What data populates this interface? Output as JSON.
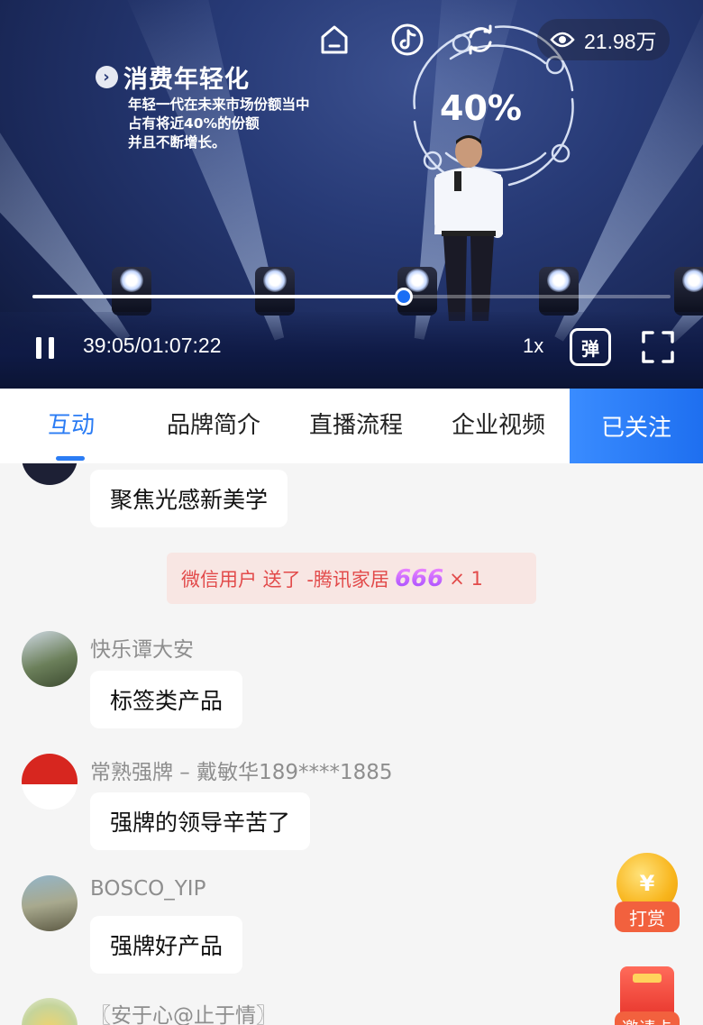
{
  "video": {
    "slide_title": "消费年轻化",
    "slide_body_lines": [
      "年轻一代在未来市场份额当中",
      "占有将近40%的份额",
      "并且不断增长。"
    ],
    "slide_stat": "40%",
    "views": "21.98万",
    "current_time": "39:05",
    "time_separator": "/",
    "total_time": "01:07:22",
    "progress": 0.582,
    "speed_label": "1x",
    "danmu_label": "弹",
    "icons": [
      "home-icon",
      "tiktok-icon",
      "refresh-icon",
      "eye-icon",
      "pause-icon",
      "fullscreen-icon"
    ]
  },
  "tabs": {
    "items": [
      "互动",
      "品牌简介",
      "直播流程",
      "企业视频"
    ],
    "active_index": 0,
    "follow_label": "已关注"
  },
  "chat": {
    "first_message": "聚焦光感新美学",
    "gift": {
      "text": "微信用户 送了 -腾讯家居",
      "icon_text": "666",
      "count": "× 1"
    },
    "messages": [
      {
        "user": "快乐谭大安",
        "text": "标签类产品"
      },
      {
        "user": "常熟强牌 – 戴敏华189****1885",
        "text": "强牌的领导辛苦了"
      },
      {
        "user": "BOSCO_YIP",
        "text": "强牌好产品"
      },
      {
        "user": "〖安于心@止于情〗",
        "text": ""
      }
    ],
    "reward_symbol": "¥",
    "reward_label": "打赏",
    "invite_label": "邀请卡"
  },
  "colors": {
    "accent": "#2b7cf4",
    "gift_text": "#e24a4a",
    "gift_bg": "#f8e6e3",
    "reward": "#f2613e"
  }
}
